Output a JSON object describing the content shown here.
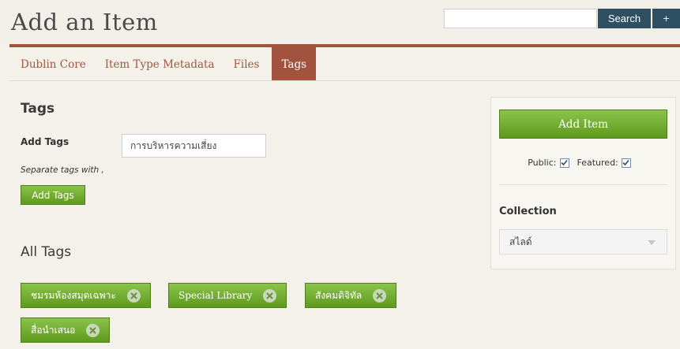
{
  "header": {
    "title": "Add an Item",
    "search_placeholder": "",
    "search_label": "Search",
    "plus_label": "+"
  },
  "tabs": [
    {
      "label": "Dublin Core"
    },
    {
      "label": "Item Type Metadata"
    },
    {
      "label": "Files"
    },
    {
      "label": "Tags",
      "active": true
    }
  ],
  "tags_section": {
    "title": "Tags",
    "add_label": "Add Tags",
    "input_value": "การบริหารความเสี่ยง",
    "hint": "Separate tags with ,",
    "add_button": "Add Tags",
    "all_tags_title": "All Tags",
    "tags": [
      "ชมรมห้องสมุดเฉพาะ",
      "Special Library",
      "สังคมดิจิทัล",
      "สื่อนำเสนอ"
    ]
  },
  "side_panel": {
    "add_item_button": "Add Item",
    "public_label": "Public:",
    "public_checked": true,
    "featured_label": "Featured:",
    "featured_checked": true,
    "collection_label": "Collection",
    "collection_value": "สไลด์"
  },
  "colors": {
    "brand": "#a1533e",
    "accent_green": "#6aa72a",
    "search_button": "#2f4f63"
  },
  "icons": {
    "remove": "remove-tag-icon",
    "check": "check-icon",
    "caret": "chevron-down-icon"
  }
}
